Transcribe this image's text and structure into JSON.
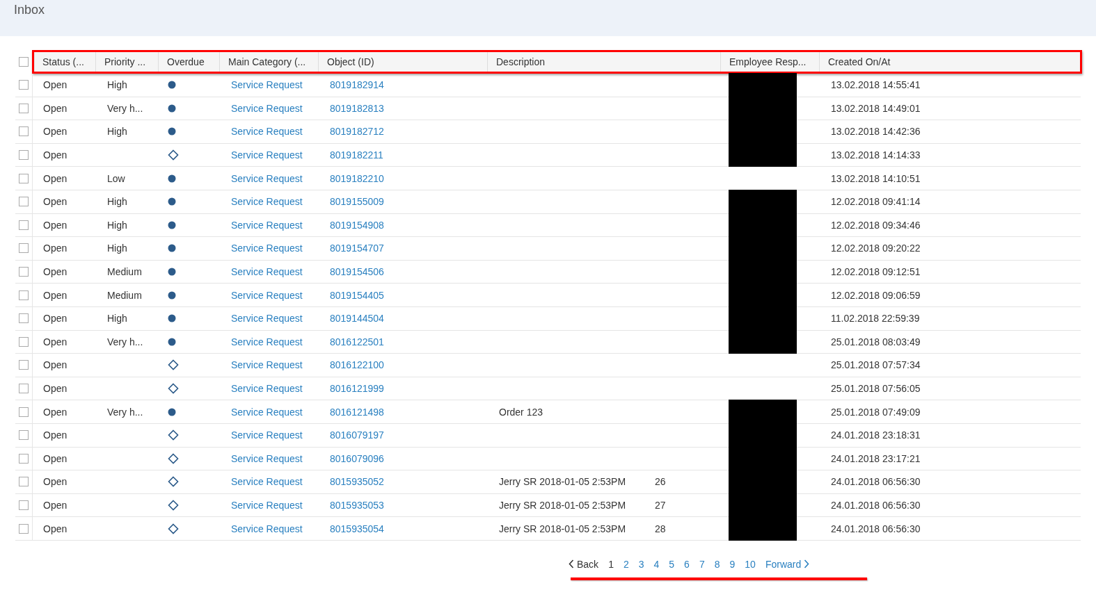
{
  "title": "Inbox",
  "table": {
    "header_checked": false,
    "columns": [
      "Status (...",
      "Priority ...",
      "Overdue",
      "Main Category (...",
      "Object (ID)",
      "Description",
      "Employee Resp...",
      "Created On/At"
    ],
    "rows": [
      {
        "checked": false,
        "status": "Open",
        "priority": "High",
        "overdue": true,
        "category": "Service Request",
        "object_id": "8019182914",
        "employee_redacted": true,
        "created": "13.02.2018 14:55:41"
      },
      {
        "checked": false,
        "status": "Open",
        "priority": "Very h...",
        "overdue": true,
        "category": "Service Request",
        "object_id": "8019182813",
        "employee_redacted": true,
        "created": "13.02.2018 14:49:01"
      },
      {
        "checked": false,
        "status": "Open",
        "priority": "High",
        "overdue": true,
        "category": "Service Request",
        "object_id": "8019182712",
        "employee_redacted": true,
        "created": "13.02.2018 14:42:36"
      },
      {
        "checked": false,
        "status": "Open",
        "overdue": false,
        "category": "Service Request",
        "object_id": "8019182211",
        "employee_redacted": true,
        "created": "13.02.2018 14:14:33"
      },
      {
        "checked": false,
        "status": "Open",
        "priority": "Low",
        "overdue": true,
        "category": "Service Request",
        "object_id": "8019182210",
        "employee_redacted": false,
        "created": "13.02.2018 14:10:51"
      },
      {
        "checked": false,
        "status": "Open",
        "priority": "High",
        "overdue": true,
        "category": "Service Request",
        "object_id": "8019155009",
        "employee_redacted": true,
        "created": "12.02.2018 09:41:14"
      },
      {
        "checked": false,
        "status": "Open",
        "priority": "High",
        "overdue": true,
        "category": "Service Request",
        "object_id": "8019154908",
        "employee_redacted": true,
        "created": "12.02.2018 09:34:46"
      },
      {
        "checked": false,
        "status": "Open",
        "priority": "High",
        "overdue": true,
        "category": "Service Request",
        "object_id": "8019154707",
        "employee_redacted": true,
        "created": "12.02.2018 09:20:22"
      },
      {
        "checked": false,
        "status": "Open",
        "priority": "Medium",
        "overdue": true,
        "category": "Service Request",
        "object_id": "8019154506",
        "employee_redacted": true,
        "created": "12.02.2018 09:12:51"
      },
      {
        "checked": false,
        "status": "Open",
        "priority": "Medium",
        "overdue": true,
        "category": "Service Request",
        "object_id": "8019154405",
        "employee_redacted": true,
        "created": "12.02.2018 09:06:59"
      },
      {
        "checked": false,
        "status": "Open",
        "priority": "High",
        "overdue": true,
        "category": "Service Request",
        "object_id": "8019144504",
        "employee_redacted": true,
        "created": "11.02.2018 22:59:39"
      },
      {
        "checked": false,
        "status": "Open",
        "priority": "Very h...",
        "overdue": true,
        "category": "Service Request",
        "object_id": "8016122501",
        "employee_redacted": true,
        "created": "25.01.2018 08:03:49"
      },
      {
        "checked": false,
        "status": "Open",
        "overdue": false,
        "category": "Service Request",
        "object_id": "8016122100",
        "employee_redacted": false,
        "created": "25.01.2018 07:57:34"
      },
      {
        "checked": false,
        "status": "Open",
        "overdue": false,
        "category": "Service Request",
        "object_id": "8016121999",
        "employee_redacted": false,
        "created": "25.01.2018 07:56:05"
      },
      {
        "checked": false,
        "status": "Open",
        "priority": "Very h...",
        "overdue": true,
        "category": "Service Request",
        "object_id": "8016121498",
        "description": "Order 123",
        "employee_redacted": true,
        "created": "25.01.2018 07:49:09"
      },
      {
        "checked": false,
        "status": "Open",
        "overdue": false,
        "category": "Service Request",
        "object_id": "8016079197",
        "employee_redacted": true,
        "created": "24.01.2018 23:18:31"
      },
      {
        "checked": false,
        "status": "Open",
        "overdue": false,
        "category": "Service Request",
        "object_id": "8016079096",
        "employee_redacted": true,
        "created": "24.01.2018 23:17:21"
      },
      {
        "checked": false,
        "status": "Open",
        "overdue": false,
        "category": "Service Request",
        "object_id": "8015935052",
        "description": "Jerry SR 2018-01-05 2:53PM",
        "description_number": "26",
        "employee_redacted": true,
        "created": "24.01.2018 06:56:30"
      },
      {
        "checked": false,
        "status": "Open",
        "overdue": false,
        "category": "Service Request",
        "object_id": "8015935053",
        "description": "Jerry SR 2018-01-05 2:53PM",
        "description_number": "27",
        "employee_redacted": true,
        "created": "24.01.2018 06:56:30"
      },
      {
        "checked": false,
        "status": "Open",
        "overdue": false,
        "category": "Service Request",
        "object_id": "8015935054",
        "description": "Jerry SR 2018-01-05 2:53PM",
        "description_number": "28",
        "employee_redacted": true,
        "created": "24.01.2018 06:56:30"
      }
    ]
  },
  "pagination": {
    "back": "Back",
    "pages": [
      {
        "label": "1",
        "selected": true
      },
      {
        "label": "2",
        "selected": false
      },
      {
        "label": "3",
        "selected": false
      },
      {
        "label": "4",
        "selected": false
      },
      {
        "label": "5",
        "selected": false
      },
      {
        "label": "6",
        "selected": false
      },
      {
        "label": "7",
        "selected": false
      },
      {
        "label": "8",
        "selected": false
      },
      {
        "label": "9",
        "selected": false
      },
      {
        "label": "10",
        "selected": false
      }
    ],
    "forward": "Forward"
  }
}
